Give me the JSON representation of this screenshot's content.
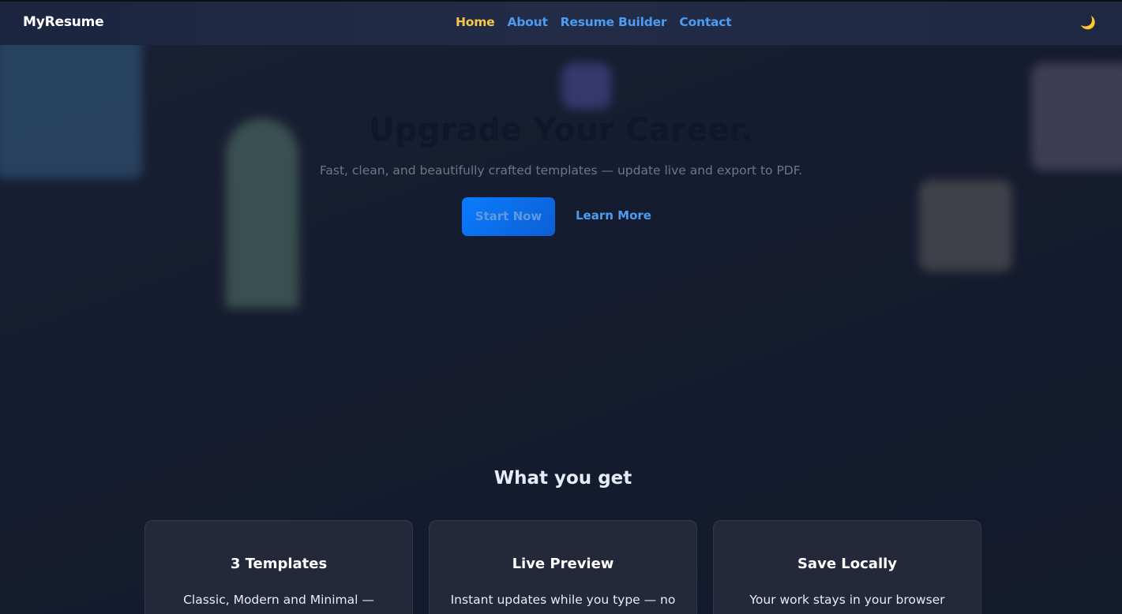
{
  "navbar": {
    "brand": "MyResume",
    "links": [
      {
        "label": "Home",
        "active": true
      },
      {
        "label": "About",
        "active": false
      },
      {
        "label": "Resume Builder",
        "active": false
      },
      {
        "label": "Contact",
        "active": false
      }
    ],
    "theme_toggle_icon": "moon-icon",
    "theme_toggle_glyph": "🌙"
  },
  "hero": {
    "title": "Upgrade Your Career.",
    "subtitle": "Fast, clean, and beautifully crafted templates — update live and export to PDF.",
    "primary_button": "Start Now",
    "secondary_button": "Learn More"
  },
  "features": {
    "title": "What you get",
    "cards": [
      {
        "title": "3 Templates",
        "description": "Classic, Modern and Minimal —"
      },
      {
        "title": "Live Preview",
        "description": "Instant updates while you type — no"
      },
      {
        "title": "Save Locally",
        "description": "Your work stays in your browser"
      }
    ]
  },
  "colors": {
    "accent": "#4c9cf2",
    "active_link": "#f5c84c",
    "primary_button": "#0a7cff",
    "background": "#151b2e"
  }
}
